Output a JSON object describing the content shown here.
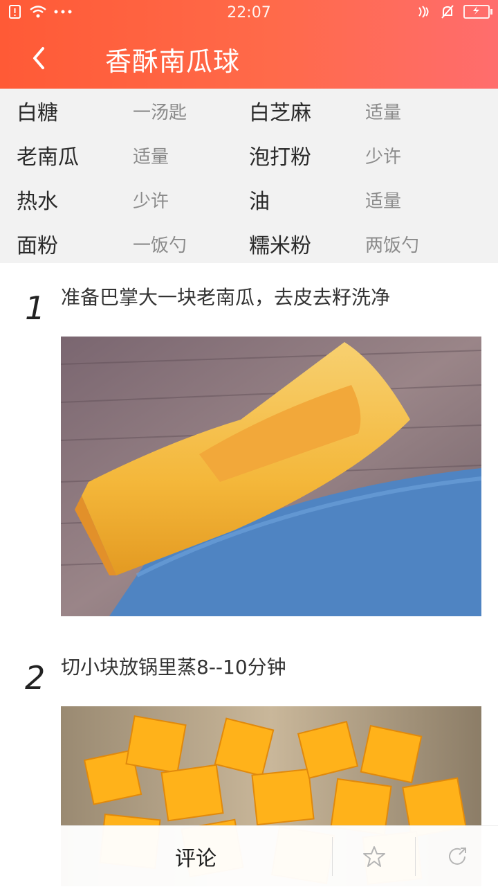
{
  "status_bar": {
    "time": "22:07"
  },
  "header": {
    "title": "香酥南瓜球",
    "back_icon": "chevron-left-icon"
  },
  "ingredients": [
    {
      "left_name": "白糖",
      "left_amount": "一汤匙",
      "right_name": "白芝麻",
      "right_amount": "适量"
    },
    {
      "left_name": "老南瓜",
      "left_amount": "适量",
      "right_name": "泡打粉",
      "right_amount": "少许"
    },
    {
      "left_name": "热水",
      "left_amount": "少许",
      "right_name": "油",
      "right_amount": "适量"
    },
    {
      "left_name": "面粉",
      "left_amount": "一饭勺",
      "right_name": "糯米粉",
      "right_amount": "两饭勺"
    }
  ],
  "steps": [
    {
      "number": "1",
      "text": "准备巴掌大一块老南瓜，去皮去籽洗净",
      "image": "pumpkin-slice-photo"
    },
    {
      "number": "2",
      "text": "切小块放锅里蒸8--10分钟",
      "image": "pumpkin-cubes-photo"
    }
  ],
  "bottom_bar": {
    "comment_label": "评论",
    "favorite_icon": "star-outline-icon",
    "share_icon": "share-icon"
  },
  "colors": {
    "header_start": "#ff5a36",
    "header_end": "#ff6d6d",
    "ingredient_bg": "#f2f2f2"
  }
}
